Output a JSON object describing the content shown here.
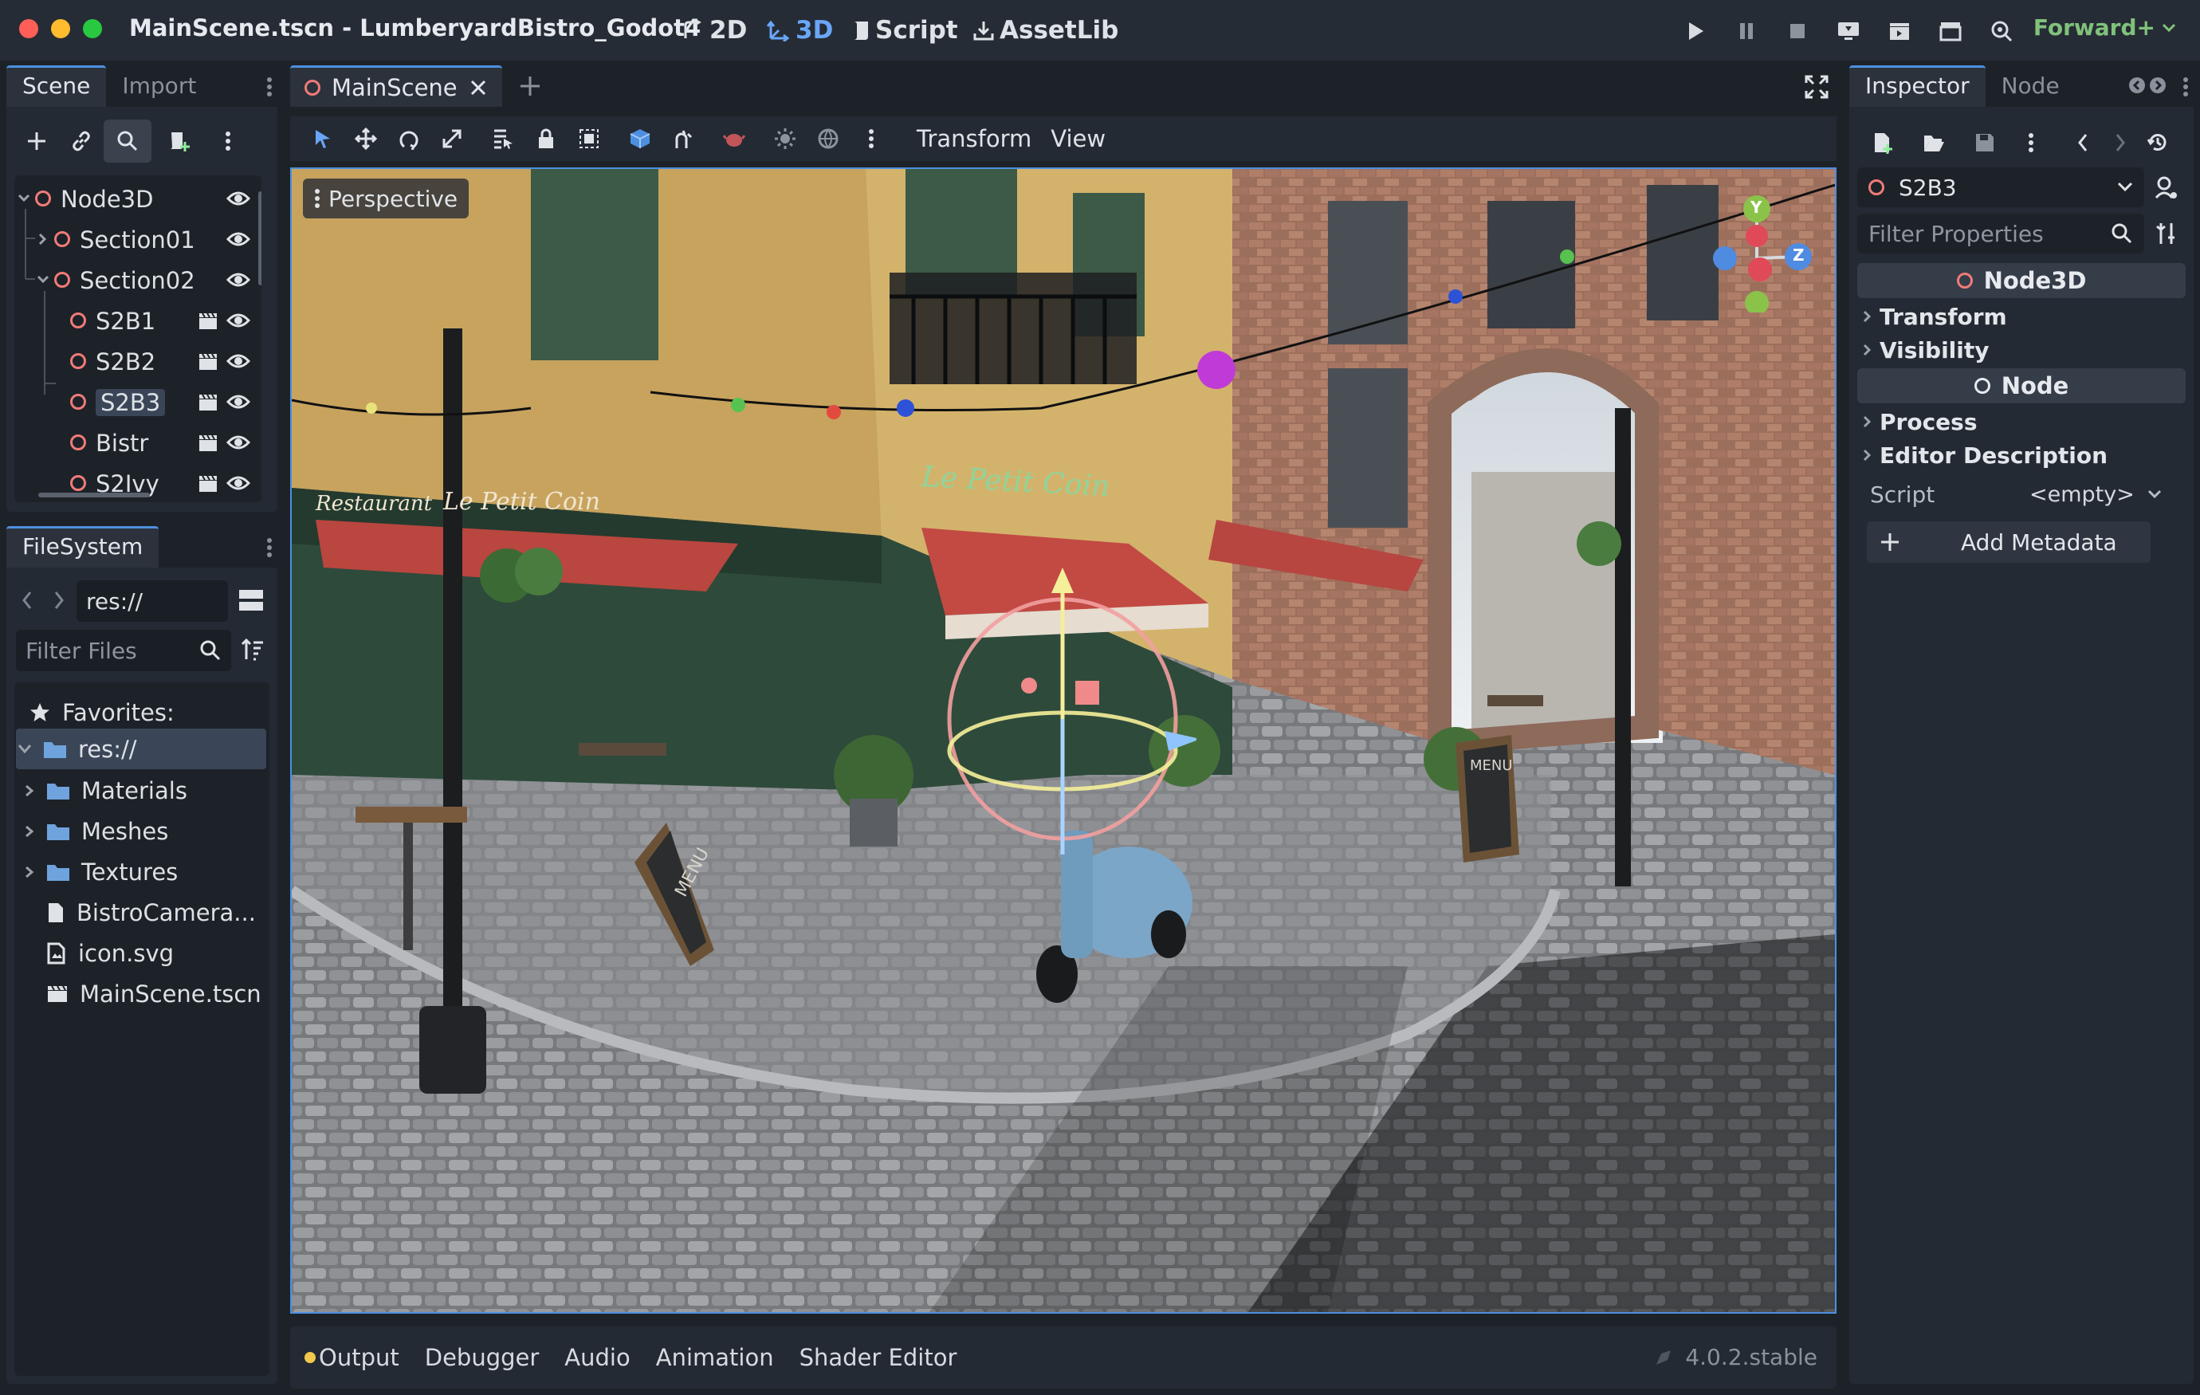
{
  "window": {
    "title": "MainScene.tscn - LumberyardBistro_Godot4",
    "traffic_colors": [
      "#ff5f57",
      "#febc2e",
      "#28c840"
    ]
  },
  "modes": {
    "items": [
      {
        "label": "2D",
        "icon": "2d-icon"
      },
      {
        "label": "3D",
        "icon": "3d-icon",
        "active": true
      },
      {
        "label": "Script",
        "icon": "script-icon"
      },
      {
        "label": "AssetLib",
        "icon": "assetlib-icon"
      }
    ]
  },
  "renderer": "Forward+",
  "scene_dock": {
    "tabs": [
      "Scene",
      "Import"
    ],
    "tree": [
      {
        "label": "Node3D",
        "depth": 0,
        "expander": "open",
        "visible": true
      },
      {
        "label": "Section01",
        "depth": 1,
        "expander": "closed",
        "visible": true
      },
      {
        "label": "Section02",
        "depth": 1,
        "expander": "open",
        "visible": true
      },
      {
        "label": "S2B1",
        "depth": 2,
        "scene": true,
        "visible": true
      },
      {
        "label": "S2B2",
        "depth": 2,
        "scene": true,
        "visible": true
      },
      {
        "label": "S2B3",
        "depth": 2,
        "scene": true,
        "visible": true,
        "selected": true
      },
      {
        "label": "Bistr",
        "depth": 2,
        "scene": true,
        "visible": true
      },
      {
        "label": "S2Ivy",
        "depth": 2,
        "scene": true,
        "visible": true
      }
    ]
  },
  "filesystem": {
    "tab": "FileSystem",
    "path": "res://",
    "filter_placeholder": "Filter Files",
    "favorites_label": "Favorites:",
    "root": "res://",
    "items": [
      {
        "label": "Materials",
        "type": "folder"
      },
      {
        "label": "Meshes",
        "type": "folder"
      },
      {
        "label": "Textures",
        "type": "folder"
      },
      {
        "label": "BistroCamera...",
        "type": "file"
      },
      {
        "label": "icon.svg",
        "type": "image"
      },
      {
        "label": "MainScene.tscn",
        "type": "scene"
      }
    ]
  },
  "editor": {
    "scene_tab": "MainScene",
    "menus": [
      "Transform",
      "View"
    ],
    "viewport_label": "Perspective",
    "gizmo_axes": [
      "Y",
      "Z"
    ],
    "signs": {
      "restaurant": "Restaurant",
      "cafe_name": "Le Petit Coin",
      "menu": "MENU"
    }
  },
  "inspector": {
    "tabs": [
      "Inspector",
      "Node"
    ],
    "selected_node": "S2B3",
    "filter_placeholder": "Filter Properties",
    "class_header": "Node3D",
    "node3d_sections": [
      "Transform",
      "Visibility"
    ],
    "node_header": "Node",
    "node_sections": [
      "Process",
      "Editor Description"
    ],
    "script_label": "Script",
    "script_value": "<empty>",
    "add_metadata": "Add Metadata"
  },
  "bottom_panel": {
    "tabs": [
      "Output",
      "Debugger",
      "Audio",
      "Animation",
      "Shader Editor"
    ],
    "output_dot_color": "#f2c94c",
    "version": "4.0.2.stable"
  },
  "colors": {
    "accent": "#4d8fe0",
    "node_red": "#f07b78",
    "folder_blue": "#6fa3dd",
    "renderer_green": "#80c27c"
  }
}
